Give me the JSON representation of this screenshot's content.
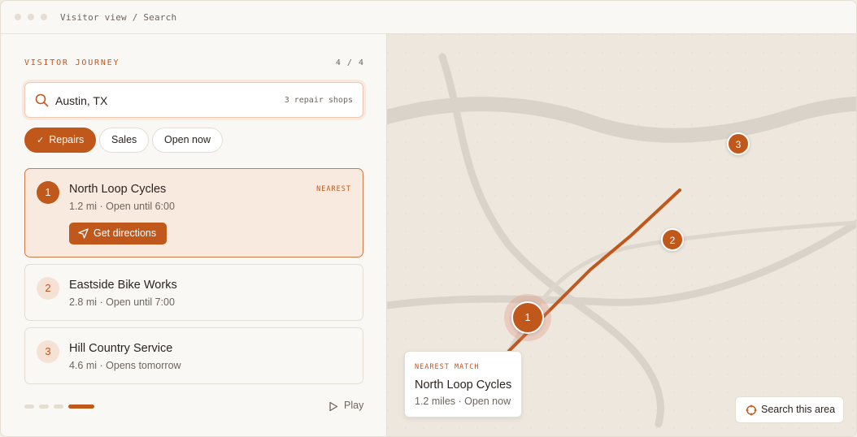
{
  "window": {
    "title": "Visitor view / Search"
  },
  "panel": {
    "journey_label": "VISITOR JOURNEY",
    "step_count": "4 / 4"
  },
  "search": {
    "value": "Austin, TX",
    "result_count": "3 repair shops"
  },
  "filters": [
    {
      "label": "Repairs",
      "active": true
    },
    {
      "label": "Sales",
      "active": false
    },
    {
      "label": "Open now",
      "active": false
    }
  ],
  "results": [
    {
      "rank": "1",
      "name": "North Loop Cycles",
      "meta": "1.2 mi · Open until 6:00",
      "tag": "NEAREST",
      "action": "Get directions",
      "selected": true
    },
    {
      "rank": "2",
      "name": "Eastside Bike Works",
      "meta": "2.8 mi · Open until 7:00",
      "selected": false
    },
    {
      "rank": "3",
      "name": "Hill Country Service",
      "meta": "4.6 mi · Opens tomorrow",
      "selected": false
    }
  ],
  "pager": {
    "total": 4,
    "current": 4
  },
  "play_label": "Play",
  "map": {
    "pins": [
      "1",
      "2",
      "3"
    ],
    "callout": {
      "label": "NEAREST MATCH",
      "name": "North Loop Cycles",
      "meta": "1.2 miles · Open now"
    },
    "search_area_label": "Search this area"
  },
  "colors": {
    "accent": "#c0571b",
    "map_bg": "#ede7de",
    "road": "#d9d3ca",
    "panel_bg": "#faf8f4"
  },
  "icons": [
    "search-icon",
    "check-icon",
    "navigation-arrow-icon",
    "play-icon",
    "crosshair-icon"
  ]
}
